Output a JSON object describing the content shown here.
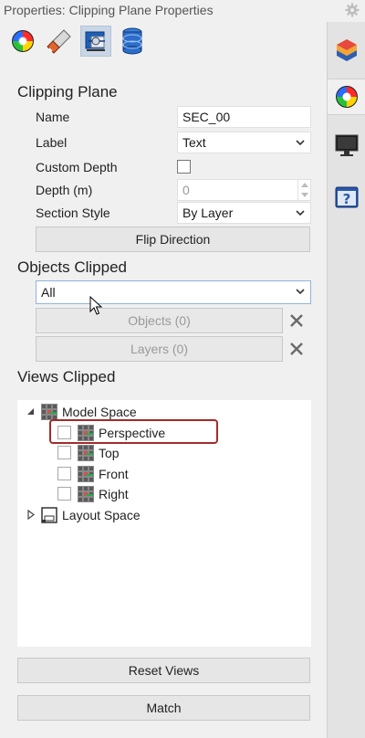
{
  "window": {
    "title": "Properties: Clipping Plane Properties"
  },
  "toolbar": {
    "icons": [
      "color-wheel-icon",
      "paint-brush-icon",
      "clipping-plane-icon",
      "layers-stack-icon"
    ]
  },
  "side_tabs": [
    "layers-icon",
    "color-wheel-icon",
    "display-icon",
    "help-icon"
  ],
  "clipping_plane": {
    "heading": "Clipping Plane",
    "name_label": "Name",
    "name_value": "SEC_00",
    "label_label": "Label",
    "label_value": "Text",
    "custom_depth_label": "Custom Depth",
    "depth_label": "Depth (m)",
    "depth_value": "0",
    "section_style_label": "Section Style",
    "section_style_value": "By Layer",
    "flip_direction_label": "Flip Direction"
  },
  "objects_clipped": {
    "heading": "Objects Clipped",
    "selected": "All",
    "objects_button": "Objects (0)",
    "layers_button": "Layers (0)"
  },
  "views_clipped": {
    "heading": "Views Clipped",
    "model_space": "Model Space",
    "views": [
      "Perspective",
      "Top",
      "Front",
      "Right"
    ],
    "layout_space": "Layout Space"
  },
  "buttons": {
    "reset_views": "Reset Views",
    "match": "Match"
  }
}
